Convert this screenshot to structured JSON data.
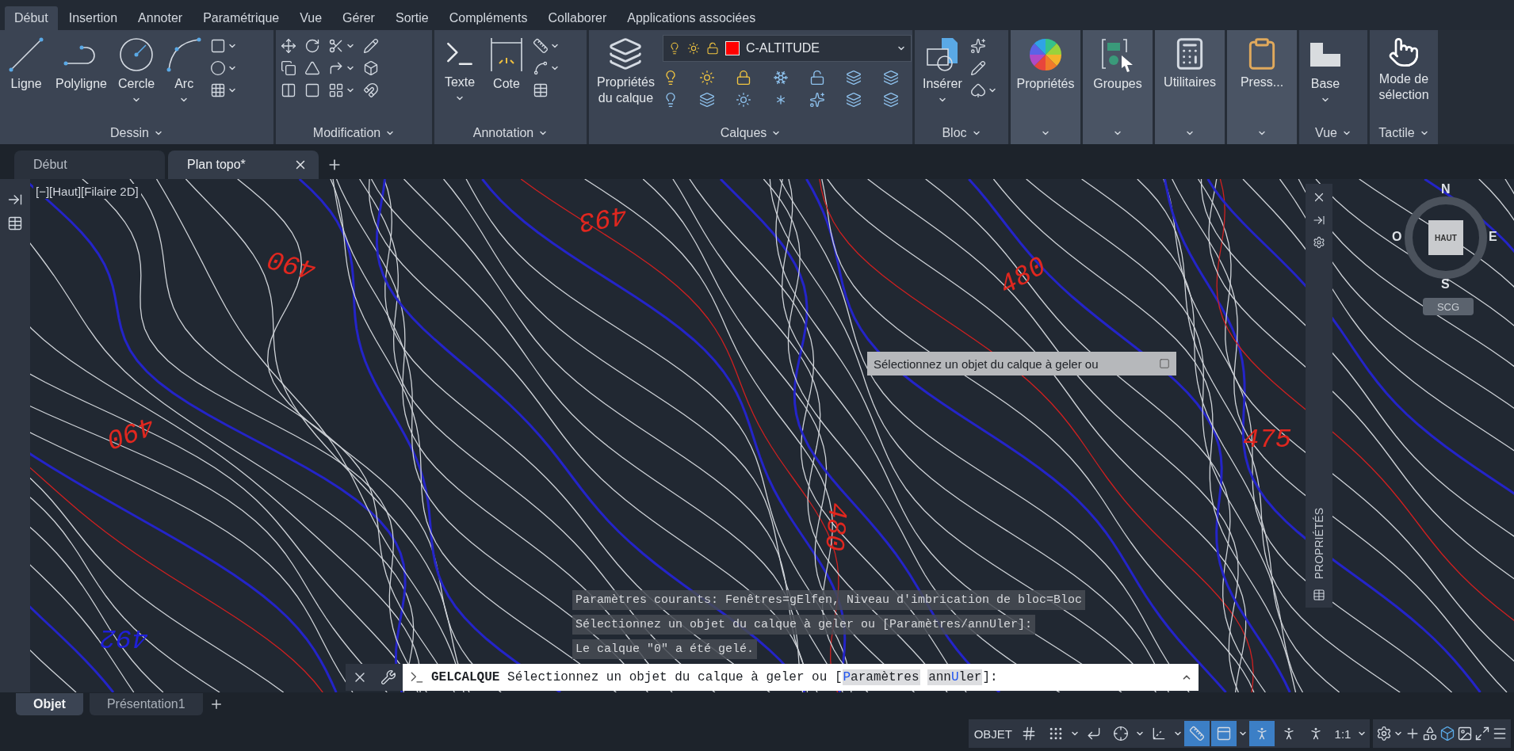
{
  "menu_tabs": [
    {
      "label": "Début",
      "selected": true
    },
    {
      "label": "Insertion",
      "selected": false
    },
    {
      "label": "Annoter",
      "selected": false
    },
    {
      "label": "Paramétrique",
      "selected": false
    },
    {
      "label": "Vue",
      "selected": false
    },
    {
      "label": "Gérer",
      "selected": false
    },
    {
      "label": "Sortie",
      "selected": false
    },
    {
      "label": "Compléments",
      "selected": false
    },
    {
      "label": "Collaborer",
      "selected": false
    },
    {
      "label": "Applications associées",
      "selected": false
    }
  ],
  "ribbon": {
    "panels": [
      {
        "kind": "tools",
        "title": "Dessin",
        "tools": [
          {
            "label": "Ligne",
            "has_menu": false
          },
          {
            "label": "Polyligne",
            "has_menu": false
          },
          {
            "label": "Cercle",
            "has_menu": true
          },
          {
            "label": "Arc",
            "has_menu": true
          }
        ]
      },
      {
        "kind": "tools",
        "title": "Modification"
      },
      {
        "kind": "tools",
        "title": "Annotation",
        "tools": [
          {
            "label": "Texte",
            "has_menu": true
          },
          {
            "label": "Cote",
            "has_menu": false
          }
        ]
      },
      {
        "kind": "layers",
        "title": "Calques",
        "tools": [
          {
            "label": "Propriétés du calque",
            "has_menu": false
          }
        ],
        "layer": {
          "name": "C-ALTITUDE",
          "color": "#ff0000"
        }
      },
      {
        "kind": "tools",
        "title": "Bloc",
        "tools": [
          {
            "label": "Insérer",
            "has_menu": true
          }
        ]
      },
      {
        "kind": "collapsed",
        "tools": [
          {
            "label": "Propriétés",
            "has_menu": false
          }
        ]
      },
      {
        "kind": "collapsed",
        "tools": [
          {
            "label": "Groupes",
            "has_menu": false
          }
        ]
      },
      {
        "kind": "collapsed",
        "tools": [
          {
            "label": "Utilitaires",
            "has_menu": false
          }
        ]
      },
      {
        "kind": "collapsed",
        "tools": [
          {
            "label": "Press...",
            "has_menu": false
          }
        ]
      },
      {
        "kind": "tools",
        "title": "Vue",
        "tools": [
          {
            "label": "Base",
            "has_menu": true
          }
        ]
      },
      {
        "kind": "tools",
        "title": "Tactile",
        "tools": [
          {
            "label": "Mode de sélection",
            "has_menu": false
          }
        ]
      }
    ]
  },
  "doc_tabs": [
    {
      "label": "Début",
      "selected": false
    },
    {
      "label": "Plan topo*",
      "selected": true
    }
  ],
  "viewport": {
    "label": "[−][Haut][Filaire 2D]",
    "contour_labels": [
      {
        "text": "493",
        "color": "#e0271f"
      },
      {
        "text": "490",
        "color": "#e0271f"
      },
      {
        "text": "480",
        "color": "#e0271f"
      },
      {
        "text": "490",
        "color": "#e0271f"
      },
      {
        "text": "475",
        "color": "#e0271f"
      },
      {
        "text": "480",
        "color": "#e0271f"
      },
      {
        "text": "492",
        "color": "#1f1fd8"
      }
    ],
    "tooltip": "Sélectionnez un objet du calque à geler ou",
    "properties_palette": "PROPRIÉTÉS",
    "viewcube": {
      "north": "N",
      "south": "S",
      "east": "E",
      "west": "O",
      "face": "HAUT",
      "ucs": "SCG"
    }
  },
  "command": {
    "history": [
      "Paramètres courants: Fenêtres=gElfen, Niveau d'imbrication de bloc=Bloc",
      "Sélectionnez un objet du calque à geler ou [Paramètres/annUler]:",
      "Le calque \"0\" a été gelé."
    ],
    "name": "GELCALQUE",
    "prompt": "Sélectionnez un objet du calque à geler ou [",
    "options": [
      {
        "key": "P",
        "after": "aramètres"
      },
      {
        "before": "ann",
        "key": "U",
        "after": "ler"
      }
    ],
    "suffix": "]:"
  },
  "layout_tabs": [
    {
      "label": "Objet",
      "selected": true
    },
    {
      "label": "Présentation1",
      "selected": false
    }
  ],
  "status_bar": {
    "space": "OBJET",
    "scale": "1:1",
    "toggles": [
      {
        "on": false
      },
      {
        "on": false
      },
      {
        "on": false
      },
      {
        "on": false
      },
      {
        "on": false
      },
      {
        "on": true
      },
      {
        "on": true
      },
      {
        "on": true
      },
      {
        "on": false
      },
      {
        "on": false
      }
    ]
  }
}
